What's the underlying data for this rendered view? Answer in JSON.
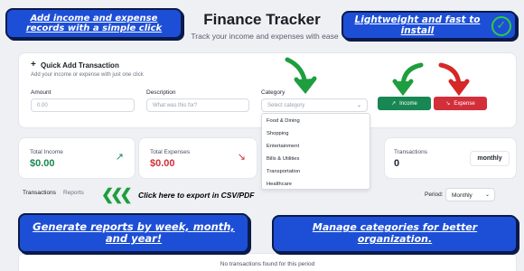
{
  "header": {
    "title": "Finance Tracker",
    "subtitle": "Track your income and expenses with ease"
  },
  "callouts": {
    "top_left": "Add income and expense records with a simple click",
    "top_right": "Lightweight and fast to install",
    "bottom_left": "Generate reports by week, month, and year!",
    "bottom_right": "Manage categories for better organization.",
    "export_hint": "Click here to export in CSV/PDF"
  },
  "quick_add": {
    "title": "Quick Add Transaction",
    "subtitle": "Add your income or expense with just one click",
    "amount_label": "Amount",
    "amount_placeholder": "0.00",
    "description_label": "Description",
    "description_placeholder": "What was this for?",
    "category_label": "Category",
    "category_placeholder": "Select category",
    "income_button": "Income",
    "expense_button": "Expense"
  },
  "category_options": [
    "Food & Dining",
    "Shopping",
    "Entertainment",
    "Bills & Utilities",
    "Transportation",
    "Healthcare"
  ],
  "stats": {
    "total_income_label": "Total Income",
    "total_income_value": "$0.00",
    "total_expenses_label": "Total Expenses",
    "total_expenses_value": "$0.00",
    "transactions_label": "Transactions",
    "transactions_value": "0",
    "frequency_chip": "monthly"
  },
  "tabs": [
    "Transactions",
    "Reports"
  ],
  "period": {
    "label": "Period:",
    "value": "Monthly"
  },
  "empty_state": "No transactions found for this period",
  "colors": {
    "income": "#198754",
    "expense": "#d32f3a",
    "callout": "#1d4fd6",
    "arrow_green": "#1e9e3e",
    "arrow_red": "#d62828"
  },
  "icons": {
    "plus": "+",
    "check": "✓",
    "trend_up": "↗",
    "trend_down": "↘",
    "chevron": "⌄",
    "export_arrows": "❮❮❮"
  }
}
